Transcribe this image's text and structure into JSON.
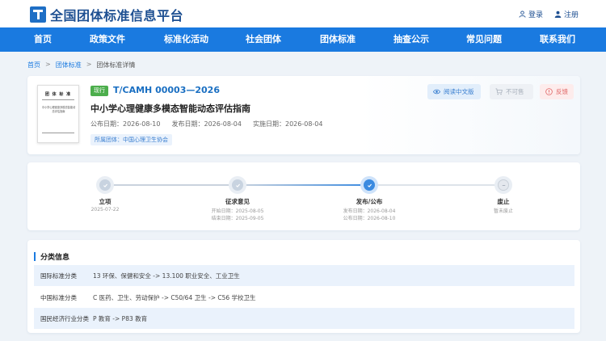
{
  "header": {
    "site_title": "全国团体标准信息平台",
    "login": "登录",
    "register": "注册"
  },
  "nav": [
    "首页",
    "政策文件",
    "标准化活动",
    "社会团体",
    "团体标准",
    "抽查公示",
    "常见问题",
    "联系我们"
  ],
  "breadcrumb": [
    "首页",
    "团体标准",
    "团体标准详情"
  ],
  "standard": {
    "status": "现行",
    "code": "T/CAMH 00003—2026",
    "title": "中小学心理健康多模态智能动态评估指南",
    "publish_date": "公布日期：2026-08-10",
    "issue_date": "发布日期：2026-08-04",
    "effective_date": "实施日期：2026-08-04",
    "org": "所属团体：中国心理卫生协会",
    "thumb_title": "团 体 标 准",
    "thumb_text": "中小学心理健康多模态智能动态评估指南",
    "btn_read": "阅读中文版",
    "btn_buy": "不可售",
    "btn_feedback": "反馈"
  },
  "timeline": [
    {
      "label": "立项",
      "sub": [
        "2025-07-22"
      ]
    },
    {
      "label": "征求意见",
      "sub": [
        "开始日期：2025-08-05",
        "结束日期：2025-09-05"
      ]
    },
    {
      "label": "发布/公布",
      "sub": [
        "发布日期：2026-08-04",
        "公布日期：2026-08-10"
      ]
    },
    {
      "label": "废止",
      "sub": [
        "暂未废止"
      ]
    }
  ],
  "classification": {
    "title": "分类信息",
    "rows": [
      {
        "key": "国际标准分类",
        "value": "13 环保、保健和安全 -> 13.100 职业安全、工业卫生"
      },
      {
        "key": "中国标准分类",
        "value": "C 医药、卫生、劳动保护 -> C50/64 卫生 -> C56 学校卫生"
      },
      {
        "key": "国民经济行业分类",
        "value": "P 教育 -> P83 教育"
      }
    ]
  },
  "colors": {
    "primary": "#1a7ae0",
    "status_green": "#4cae4c",
    "feedback_red": "#e06666"
  }
}
